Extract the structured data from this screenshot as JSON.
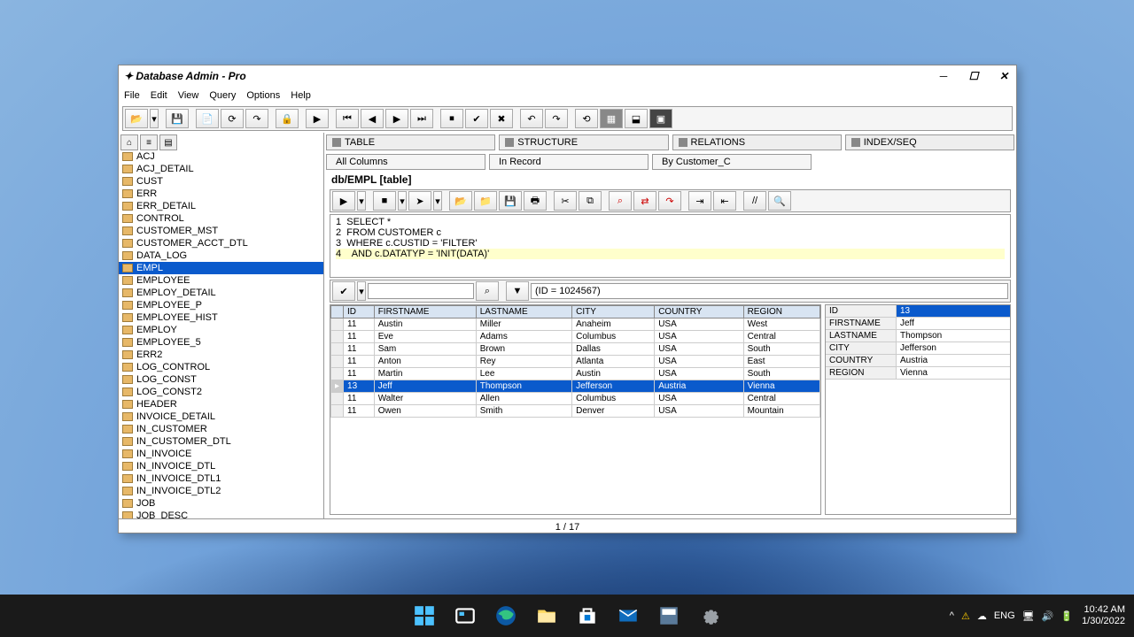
{
  "window": {
    "title": "Database Admin - Pro"
  },
  "menu": [
    "File",
    "Edit",
    "View",
    "Query",
    "Options",
    "Help"
  ],
  "sidebar": {
    "items": [
      "ACJ",
      "ACJ_DETAIL",
      "CUST",
      "ERR",
      "ERR_DETAIL",
      "CONTROL",
      "CUSTOMER_MST",
      "CUSTOMER_ACCT_DTL",
      "DATA_LOG",
      "EMPL",
      "EMPLOYEE",
      "EMPLOY_DETAIL",
      "EMPLOYEE_P",
      "EMPLOYEE_HIST",
      "EMPLOY",
      "EMPLOYEE_5",
      "ERR2",
      "LOG_CONTROL",
      "LOG_CONST",
      "LOG_CONST2",
      "HEADER",
      "INVOICE_DETAIL",
      "IN_CUSTOMER",
      "IN_CUSTOMER_DTL",
      "IN_INVOICE",
      "IN_INVOICE_DTL",
      "IN_INVOICE_DTL1",
      "IN_INVOICE_DTL2",
      "JOB",
      "JOB_DESC"
    ],
    "selected_index": 9
  },
  "top_tabs": [
    "TABLE",
    "STRUCTURE",
    "RELATIONS",
    "INDEX/SEQ"
  ],
  "sub_tabs": [
    "All Columns",
    "In Record",
    "By Customer_C"
  ],
  "path": "db/EMPL [table]",
  "code": {
    "lines": [
      "1  SELECT *",
      "2  FROM CUSTOMER c",
      "3  WHERE c.CUSTID = 'FILTER'",
      "4    AND c.DATATYP = 'INIT(DATA)'"
    ],
    "highlight_index": 3
  },
  "filter": {
    "combo": "",
    "expr": "(ID = 1024567)"
  },
  "grid": {
    "columns": [
      "ID",
      "FIRSTNAME",
      "LASTNAME",
      "CITY",
      "COUNTRY",
      "REGION"
    ],
    "rows": [
      [
        "11",
        "Austin",
        "Miller",
        "Anaheim",
        "USA",
        "West"
      ],
      [
        "11",
        "Eve",
        "Adams",
        "Columbus",
        "USA",
        "Central"
      ],
      [
        "11",
        "Sam",
        "Brown",
        "Dallas",
        "USA",
        "South"
      ],
      [
        "11",
        "Anton",
        "Rey",
        "Atlanta",
        "USA",
        "East"
      ],
      [
        "11",
        "Martin",
        "Lee",
        "Austin",
        "USA",
        "South"
      ],
      [
        "13",
        "Jeff",
        "Thompson",
        "Jefferson",
        "Austria",
        "Vienna"
      ],
      [
        "11",
        "Walter",
        "Allen",
        "Columbus",
        "USA",
        "Central"
      ],
      [
        "11",
        "Owen",
        "Smith",
        "Denver",
        "USA",
        "Mountain"
      ]
    ],
    "selected_row": 5
  },
  "detail": {
    "rows": [
      [
        "ID",
        "13"
      ],
      [
        "FIRSTNAME",
        "Jeff"
      ],
      [
        "LASTNAME",
        "Thompson"
      ],
      [
        "CITY",
        "Jefferson"
      ],
      [
        "COUNTRY",
        "Austria"
      ],
      [
        "REGION",
        "Vienna"
      ]
    ],
    "selected_row": 0
  },
  "status": {
    "center": "1 / 17"
  },
  "taskbar": {
    "lang": "ENG",
    "time": "10:42 AM",
    "date": "1/30/2022"
  }
}
